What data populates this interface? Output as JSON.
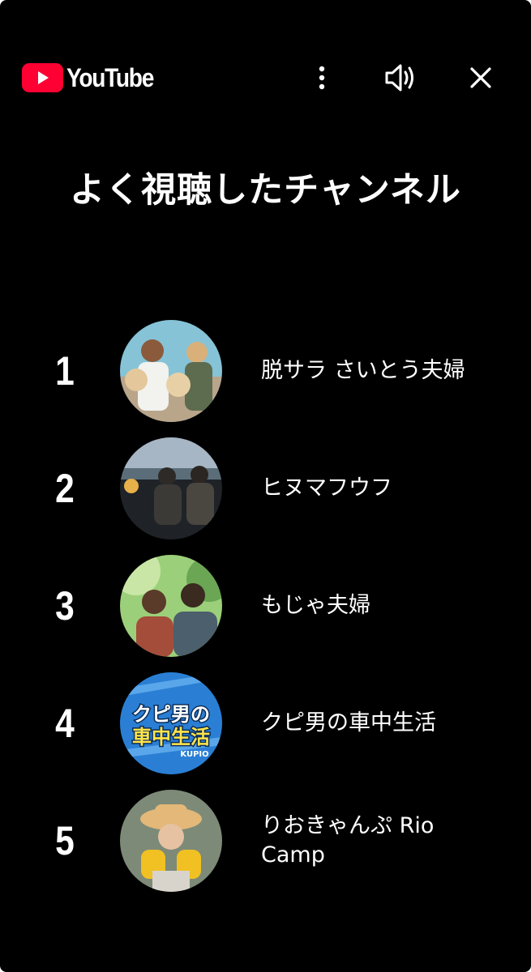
{
  "header": {
    "brand": "YouTube",
    "icons": {
      "logo": "youtube-play-icon",
      "menu": "more-vert-icon",
      "sound": "volume-icon",
      "close": "close-icon"
    },
    "brand_color": "#FF0033"
  },
  "title": "よく視聴したチャンネル",
  "channels": [
    {
      "rank": "1",
      "name": "脱サラ さいとう夫婦"
    },
    {
      "rank": "2",
      "name": "ヒヌマフウフ"
    },
    {
      "rank": "3",
      "name": "もじゃ夫婦"
    },
    {
      "rank": "4",
      "name": "クピ男の車中生活"
    },
    {
      "rank": "5",
      "name": "りおきゃんぷ Rio Camp"
    }
  ],
  "avatar_badges": {
    "channel_4": [
      "クピ男の",
      "車中生活",
      "KUPIO"
    ]
  }
}
